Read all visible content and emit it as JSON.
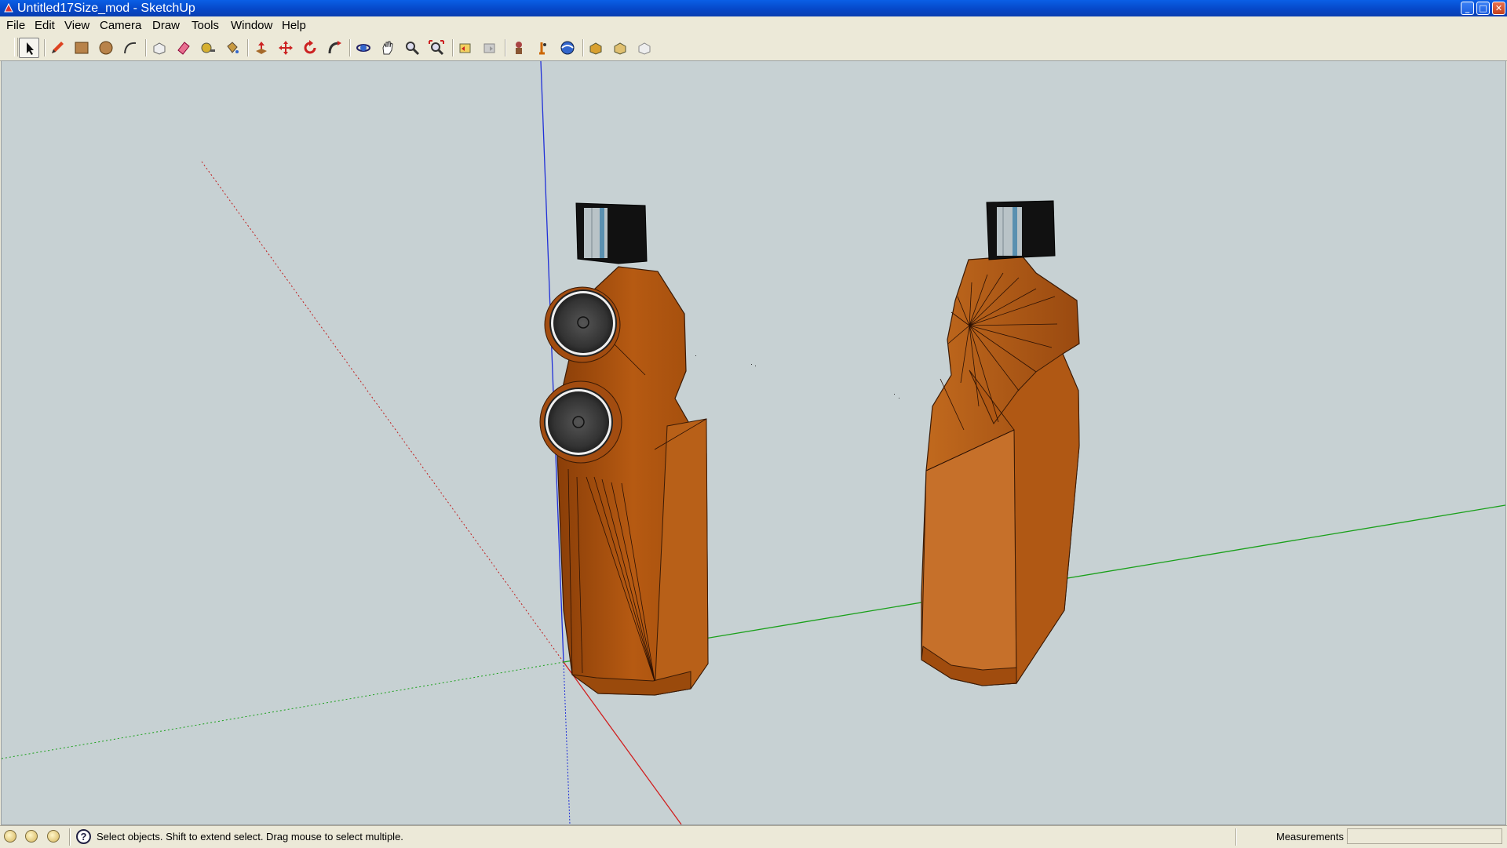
{
  "window": {
    "title": "Untitled17Size_mod - SketchUp"
  },
  "menu": {
    "items": [
      "File",
      "Edit",
      "View",
      "Camera",
      "Draw",
      "Tools",
      "Window",
      "Help"
    ]
  },
  "toolbar": {
    "tools": [
      "select-icon",
      "pencil-icon",
      "rectangle-icon",
      "circle-icon",
      "arc-icon",
      "make-component-icon",
      "eraser-icon",
      "tape-measure-icon",
      "paint-bucket-icon",
      "push-pull-icon",
      "move-icon",
      "rotate-icon",
      "follow-me-icon",
      "orbit-icon",
      "pan-icon",
      "zoom-icon",
      "zoom-extents-icon",
      "previous-view-icon",
      "next-view-icon",
      "position-camera-icon",
      "walk-icon",
      "look-around-icon",
      "get-models-icon",
      "share-model-icon",
      "share-component-icon"
    ],
    "active_tool": "select-icon"
  },
  "colors": {
    "viewport_background": "#c7d1d3",
    "wood": "#b85c12",
    "blue_axis": "#2030d8",
    "green_axis": "#1aa01a",
    "red_axis": "#d02020"
  },
  "statusbar": {
    "hint": "Select objects. Shift to extend select. Drag mouse to select multiple.",
    "measurements_label": "Measurements",
    "measurements_value": ""
  }
}
